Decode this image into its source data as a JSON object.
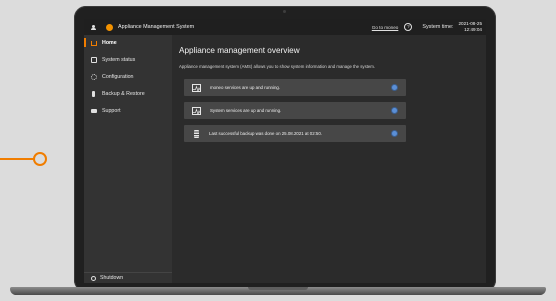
{
  "app": {
    "title": "Appliance Management System",
    "moneo_link": "Go to moneo",
    "help_symbol": "?",
    "system_time_label": "System time:",
    "system_date": "2021-08-25",
    "system_clock": "12:49:04"
  },
  "sidebar": {
    "items": [
      {
        "label": "Home",
        "icon": "home-icon",
        "active": true
      },
      {
        "label": "System status",
        "icon": "status-icon"
      },
      {
        "label": "Configuration",
        "icon": "gear-icon"
      },
      {
        "label": "Backup & Restore",
        "icon": "backup-icon"
      },
      {
        "label": "Support",
        "icon": "chat-icon"
      }
    ],
    "shutdown_label": "Shutdown"
  },
  "main": {
    "title": "Appliance management overview",
    "description": "Appliance management system (AMS) allows you to show system information and manage the system.",
    "cards": [
      {
        "text": "moneo services are up and running.",
        "icon": "pulse-icon"
      },
      {
        "text": "System services are up and running.",
        "icon": "pulse-icon"
      },
      {
        "text": "Last successful backup was done on 25.08.2021 at 02:50.",
        "icon": "database-icon"
      }
    ]
  },
  "colors": {
    "accent": "#f07d00",
    "status_ok": "#5b8fd6",
    "background": "#2b2b2b"
  }
}
